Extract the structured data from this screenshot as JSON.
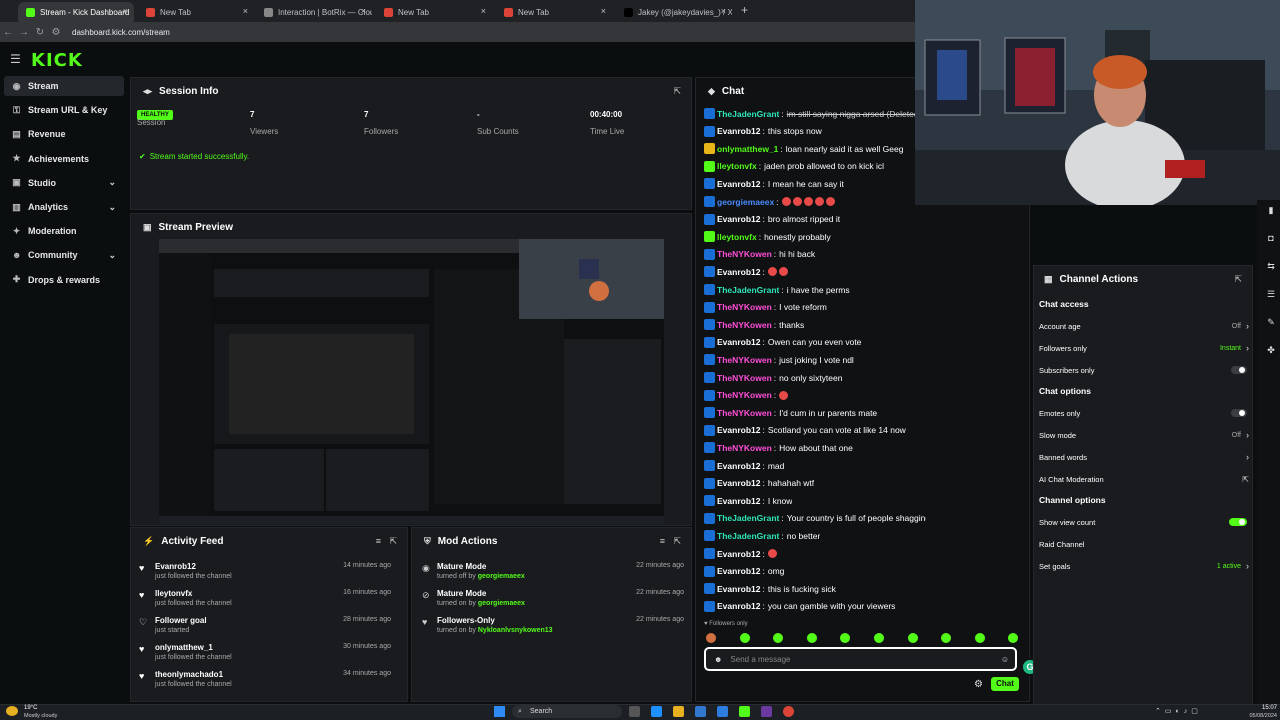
{
  "browser": {
    "tabs": [
      {
        "label": "Stream - Kick Dashboard",
        "active": true
      },
      {
        "label": "New Tab",
        "active": false
      },
      {
        "label": "Interaction | BotRix — Cloud S",
        "active": false
      },
      {
        "label": "New Tab",
        "active": false
      },
      {
        "label": "New Tab",
        "active": false
      },
      {
        "label": "Jakey (@jakeydavies_) / X",
        "active": false
      }
    ],
    "url": "dashboard.kick.com/stream",
    "new_tab": "+"
  },
  "app": {
    "logo": "KICK"
  },
  "sidebar": {
    "items": [
      {
        "label": "Stream",
        "icon": "broadcast-icon",
        "glyph": "◉",
        "chevron": false,
        "selected": true
      },
      {
        "label": "Stream URL & Key",
        "icon": "key-icon",
        "glyph": "⚿",
        "chevron": false,
        "selected": false
      },
      {
        "label": "Revenue",
        "icon": "revenue-icon",
        "glyph": "▤",
        "chevron": false,
        "selected": false
      },
      {
        "label": "Achievements",
        "icon": "trophy-icon",
        "glyph": "★",
        "chevron": false,
        "selected": false
      },
      {
        "label": "Studio",
        "icon": "studio-icon",
        "glyph": "▣",
        "chevron": true,
        "selected": false
      },
      {
        "label": "Analytics",
        "icon": "analytics-icon",
        "glyph": "▥",
        "chevron": true,
        "selected": false
      },
      {
        "label": "Moderation",
        "icon": "hammer-icon",
        "glyph": "✦",
        "chevron": false,
        "selected": false
      },
      {
        "label": "Community",
        "icon": "community-icon",
        "glyph": "☻",
        "chevron": true,
        "selected": false
      },
      {
        "label": "Drops & rewards",
        "icon": "gift-icon",
        "glyph": "✚",
        "chevron": false,
        "selected": false
      }
    ]
  },
  "session": {
    "title": "Session Info",
    "badge": "HEALTHY",
    "stats": [
      {
        "value": "",
        "label": "Session"
      },
      {
        "value": "7",
        "label": "Viewers"
      },
      {
        "value": "7",
        "label": "Followers"
      },
      {
        "value": "-",
        "label": "Sub Counts"
      },
      {
        "value": "00:40:00",
        "label": "Time Live"
      }
    ],
    "message": "Stream started successfully."
  },
  "preview": {
    "title": "Stream Preview"
  },
  "activity": {
    "title": "Activity Feed",
    "items": [
      {
        "name": "Evanrob12",
        "sub": "just followed the channel",
        "time": "14 minutes ago",
        "filled": true
      },
      {
        "name": "lleytonvfx",
        "sub": "just followed the channel",
        "time": "16 minutes ago",
        "filled": true
      },
      {
        "name": "Follower goal",
        "sub": "just started",
        "time": "28 minutes ago",
        "filled": false
      },
      {
        "name": "onlymatthew_1",
        "sub": "just followed the channel",
        "time": "30 minutes ago",
        "filled": true
      },
      {
        "name": "theonlymachado1",
        "sub": "just followed the channel",
        "time": "34 minutes ago",
        "filled": true
      }
    ]
  },
  "mod": {
    "title": "Mod Actions",
    "items": [
      {
        "name": "Mature Mode",
        "pre": "turned off by",
        "by": "georgiemaeex",
        "time": "22 minutes ago",
        "icon": "eye-icon",
        "glyph": "◉"
      },
      {
        "name": "Mature Mode",
        "pre": "turned on by",
        "by": "georgiemaeex",
        "time": "22 minutes ago",
        "icon": "eye-off-icon",
        "glyph": "⊘"
      },
      {
        "name": "Followers-Only",
        "pre": "turned on by",
        "by": "Nykloanlvsnykowen13",
        "time": "22 minutes ago",
        "icon": "heart-icon",
        "glyph": "♥"
      }
    ]
  },
  "chat": {
    "title": "Chat",
    "messages": [
      {
        "user": "TheJadenGrant",
        "color": "#2ee6b8",
        "text": "im still saying nigga arsed (Deleted)",
        "badge": "b",
        "strike": true
      },
      {
        "user": "Evanrob12",
        "color": "#ffffff",
        "text": "this stops now",
        "badge": "b"
      },
      {
        "user": "onlymatthew_1",
        "color": "#53fc18",
        "text": "loan nearly said it as well Geeg",
        "badge": "y"
      },
      {
        "user": "lleytonvfx",
        "color": "#53fc18",
        "text": "jaden prob allowed to on kick icl",
        "badge": "g"
      },
      {
        "user": "Evanrob12",
        "color": "#ffffff",
        "text": "I mean he can say it",
        "badge": "b"
      },
      {
        "user": "georgiemaeex",
        "color": "#4a8cff",
        "text": "",
        "emotes": 5,
        "badge": "b"
      },
      {
        "user": "Evanrob12",
        "color": "#ffffff",
        "text": "bro almost ripped it",
        "badge": "b"
      },
      {
        "user": "lleytonvfx",
        "color": "#53fc18",
        "text": "honestly probably",
        "badge": "g"
      },
      {
        "user": "TheNYKowen",
        "color": "#ff4fd8",
        "text": "hi hi back",
        "badge": "b"
      },
      {
        "user": "Evanrob12",
        "color": "#ffffff",
        "text": "",
        "emotes": 2,
        "badge": "b"
      },
      {
        "user": "TheJadenGrant",
        "color": "#2ee6b8",
        "text": "i have the perms",
        "badge": "b"
      },
      {
        "user": "TheNYKowen",
        "color": "#ff4fd8",
        "text": "I vote reform",
        "badge": "b"
      },
      {
        "user": "TheNYKowen",
        "color": "#ff4fd8",
        "text": "thanks",
        "badge": "b"
      },
      {
        "user": "Evanrob12",
        "color": "#ffffff",
        "text": "Owen can you even vote",
        "badge": "b"
      },
      {
        "user": "TheNYKowen",
        "color": "#ff4fd8",
        "text": "just joking I vote ndl",
        "badge": "b"
      },
      {
        "user": "TheNYKowen",
        "color": "#ff4fd8",
        "text": "no only sixtyteen",
        "badge": "b"
      },
      {
        "user": "TheNYKowen",
        "color": "#ff4fd8",
        "text": "",
        "emotes": 1,
        "badge": "b"
      },
      {
        "user": "TheNYKowen",
        "color": "#ff4fd8",
        "text": "I'd cum in ur parents mate",
        "badge": "b"
      },
      {
        "user": "Evanrob12",
        "color": "#ffffff",
        "text": "Scotland you can vote at like 14 now",
        "badge": "b"
      },
      {
        "user": "TheNYKowen",
        "color": "#ff4fd8",
        "text": "How about that one",
        "badge": "b"
      },
      {
        "user": "Evanrob12",
        "color": "#ffffff",
        "text": "mad",
        "badge": "b"
      },
      {
        "user": "Evanrob12",
        "color": "#ffffff",
        "text": "hahahah wtf",
        "badge": "b"
      },
      {
        "user": "Evanrob12",
        "color": "#ffffff",
        "text": "I know",
        "badge": "b"
      },
      {
        "user": "TheJadenGrant",
        "color": "#2ee6b8",
        "text": "Your country is full of people shagging sheep mate",
        "badge": "b"
      },
      {
        "user": "TheJadenGrant",
        "color": "#2ee6b8",
        "text": "no better",
        "badge": "b"
      },
      {
        "user": "Evanrob12",
        "color": "#ffffff",
        "text": "",
        "emotes": 1,
        "badge": "b"
      },
      {
        "user": "Evanrob12",
        "color": "#ffffff",
        "text": "omg",
        "badge": "b"
      },
      {
        "user": "Evanrob12",
        "color": "#ffffff",
        "text": "this is fucking sick",
        "badge": "b"
      },
      {
        "user": "Evanrob12",
        "color": "#ffffff",
        "text": "you can gamble with your viewers",
        "badge": "b"
      }
    ],
    "followers_only": "Followers only",
    "input_placeholder": "Send a message",
    "send_label": "Chat"
  },
  "channel_actions": {
    "title": "Channel Actions",
    "sections": [
      {
        "heading": "Chat access",
        "rows": [
          {
            "label": "Account age",
            "value": "Off",
            "control": "chevron"
          },
          {
            "label": "Followers only",
            "value": "Instant",
            "control": "chevron",
            "accent": true
          },
          {
            "label": "Subscribers only",
            "value": "",
            "control": "toggle",
            "on": false
          }
        ]
      },
      {
        "heading": "Chat options",
        "rows": [
          {
            "label": "Emotes only",
            "value": "",
            "control": "toggle",
            "on": false
          },
          {
            "label": "Slow mode",
            "value": "Off",
            "control": "chevron"
          },
          {
            "label": "Banned words",
            "value": "",
            "control": "chevron"
          },
          {
            "label": "AI Chat Moderation",
            "value": "",
            "control": "external"
          }
        ]
      },
      {
        "heading": "Channel options",
        "rows": [
          {
            "label": "Show view count",
            "value": "",
            "control": "toggle",
            "on": true
          },
          {
            "label": "Raid Channel",
            "value": "",
            "control": "none"
          },
          {
            "label": "Set goals",
            "value": "1 active",
            "control": "chevron",
            "accent": true
          }
        ]
      }
    ]
  },
  "taskbar": {
    "weather_temp": "19°C",
    "weather_desc": "Mostly cloudy",
    "search": "Search",
    "time": "15:07",
    "date": "05/08/2024"
  },
  "colors": {
    "accent": "#53fc18",
    "bg": "#0b0e0f",
    "panel": "#191b1f"
  }
}
